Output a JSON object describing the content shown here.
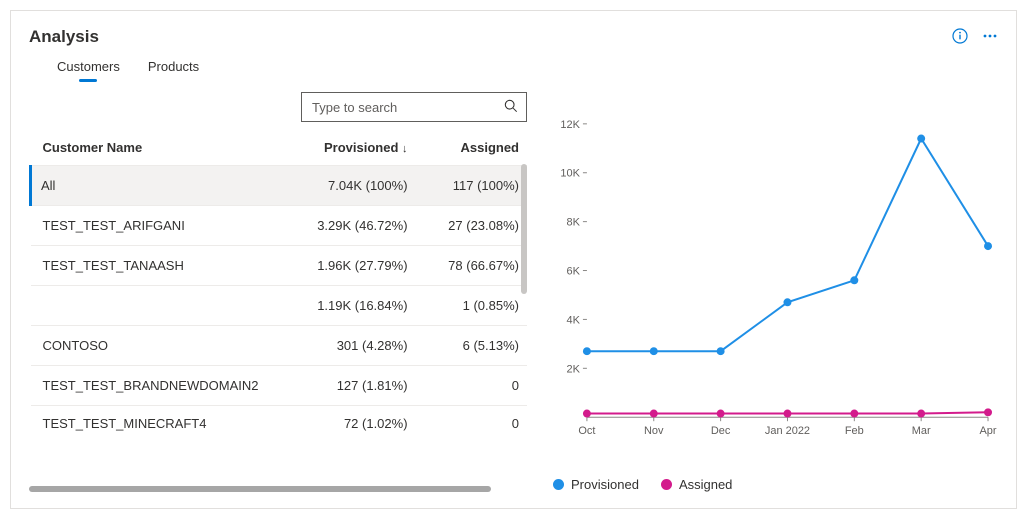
{
  "card": {
    "title": "Analysis"
  },
  "tabs": {
    "customers": "Customers",
    "products": "Products",
    "active": "customers"
  },
  "search": {
    "placeholder": "Type to search"
  },
  "columns": {
    "name": "Customer Name",
    "provisioned": "Provisioned",
    "assigned": "Assigned",
    "sort_indicator": "↓"
  },
  "rows": {
    "all": {
      "name": "All",
      "prov": "7.04K (100%)",
      "asg": "117 (100%)"
    },
    "r1": {
      "name": "TEST_TEST_ARIFGANI",
      "prov": "3.29K (46.72%)",
      "asg": "27 (23.08%)"
    },
    "r2": {
      "name": "TEST_TEST_TANAASH",
      "prov": "1.96K (27.79%)",
      "asg": "78 (66.67%)"
    },
    "r3": {
      "name": "",
      "prov": "1.19K (16.84%)",
      "asg": "1 (0.85%)"
    },
    "r4": {
      "name": "CONTOSO",
      "prov": "301 (4.28%)",
      "asg": "6 (5.13%)"
    },
    "r5": {
      "name": "TEST_TEST_BRANDNEWDOMAIN2",
      "prov": "127 (1.81%)",
      "asg": "0"
    },
    "r6": {
      "name": "TEST_TEST_MINECRAFT4",
      "prov": "72 (1.02%)",
      "asg": "0"
    }
  },
  "legend": {
    "provisioned": "Provisioned",
    "assigned": "Assigned"
  },
  "colors": {
    "provisioned": "#1f8fe6",
    "assigned": "#d31b8c",
    "axis": "#8a8886"
  },
  "chart_data": {
    "type": "line",
    "title": "",
    "xlabel": "",
    "ylabel": "",
    "ylim": [
      0,
      12000
    ],
    "categories": [
      "Oct",
      "Nov",
      "Dec",
      "Jan 2022",
      "Feb",
      "Mar",
      "Apr"
    ],
    "y_ticks": [
      "2K",
      "4K",
      "6K",
      "8K",
      "10K",
      "12K"
    ],
    "series": [
      {
        "name": "Provisioned",
        "color": "#1f8fe6",
        "values": [
          2700,
          2700,
          2700,
          4700,
          5600,
          11400,
          7000
        ]
      },
      {
        "name": "Assigned",
        "color": "#d31b8c",
        "values": [
          150,
          150,
          150,
          150,
          150,
          150,
          200
        ]
      }
    ]
  }
}
